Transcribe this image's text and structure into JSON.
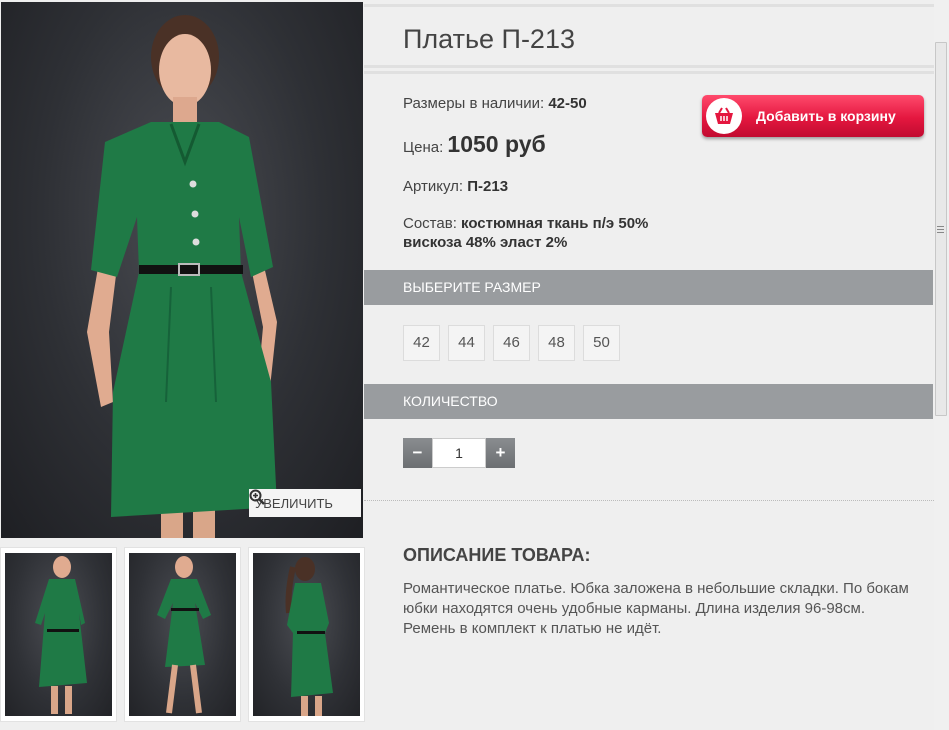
{
  "product": {
    "title": "Платье П-213",
    "sizes_label": "Размеры в наличии:",
    "sizes_value": "42-50",
    "price_label": "Цена:",
    "price_value": "1050 руб",
    "article_label": "Артикул:",
    "article_value": "П-213",
    "composition_label": "Состав:",
    "composition_line1": "костюмная ткань п/э 50%",
    "composition_line2": "вискоза 48% эласт 2%"
  },
  "cart": {
    "label": "Добавить в корзину",
    "icon": "basket-icon",
    "color": "#e4173f"
  },
  "image": {
    "zoom_label": "УВЕЛИЧИТЬ",
    "zoom_icon": "zoom-in-icon"
  },
  "size_section": {
    "title": "ВЫБЕРИТЕ РАЗМЕР",
    "sizes": [
      "42",
      "44",
      "46",
      "48",
      "50"
    ]
  },
  "quantity_section": {
    "title": "КОЛИЧЕСТВО",
    "minus": "−",
    "plus": "+",
    "value": "1"
  },
  "description": {
    "title": "ОПИСАНИЕ ТОВАРА:",
    "text": "Романтическое платье. Юбка заложена в небольшие складки. По бокам юбки находятся очень удобные карманы. Длина изделия 96-98см. Ремень в комплект к платью не идёт."
  },
  "colors": {
    "dress": "#1f7a46",
    "section_bar": "#999c9f",
    "background": "#efefef"
  }
}
